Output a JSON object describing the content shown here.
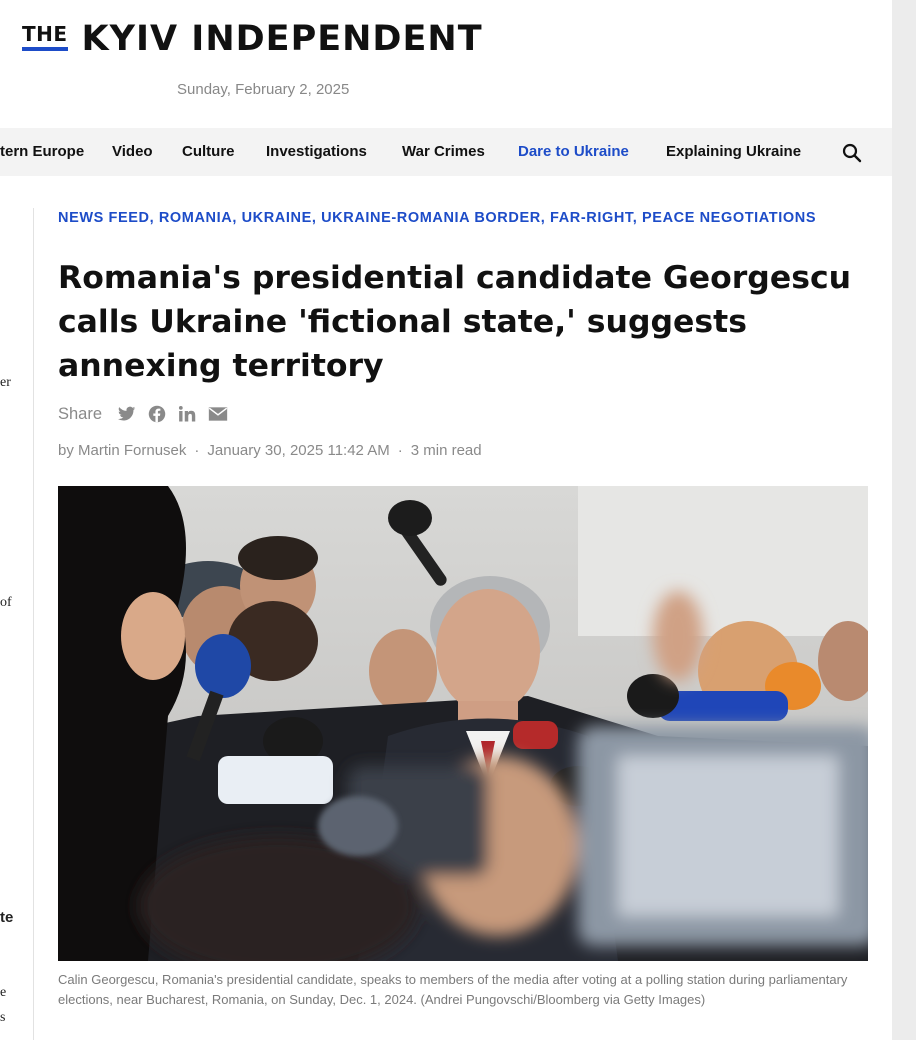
{
  "masthead": {
    "logo_the": "THE",
    "logo_name": "KYIV INDEPENDENT",
    "date": "Sunday, February 2, 2025"
  },
  "nav": {
    "items": [
      "tern Europe",
      "Video",
      "Culture",
      "Investigations",
      "War Crimes",
      "Dare to Ukraine",
      "Explaining Ukraine"
    ],
    "accent_color": "#1d4cc8"
  },
  "sidebar": {
    "fragments": [
      "er",
      "of",
      "te",
      "e",
      "s"
    ]
  },
  "article": {
    "tags": "NEWS FEED, ROMANIA, UKRAINE, UKRAINE-ROMANIA BORDER, FAR-RIGHT, PEACE NEGOTIATIONS",
    "headline": "Romania's presidential candidate Georgescu calls Ukraine 'fictional state,' suggests annexing territory",
    "share_label": "Share",
    "share_icons": [
      "twitter-icon",
      "facebook-icon",
      "linkedin-icon",
      "mail-icon"
    ],
    "author": "by Martin Fornusek",
    "date": "January 30, 2025 11:42 AM",
    "read_time": "3 min read",
    "caption": "Calin Georgescu, Romania's presidential candidate, speaks to members of the media after voting at a polling station during parliamentary elections, near Bucharest, Romania, on Sunday, Dec. 1, 2024. (Andrei Pungovschi/Bloomberg via Getty Images)"
  }
}
